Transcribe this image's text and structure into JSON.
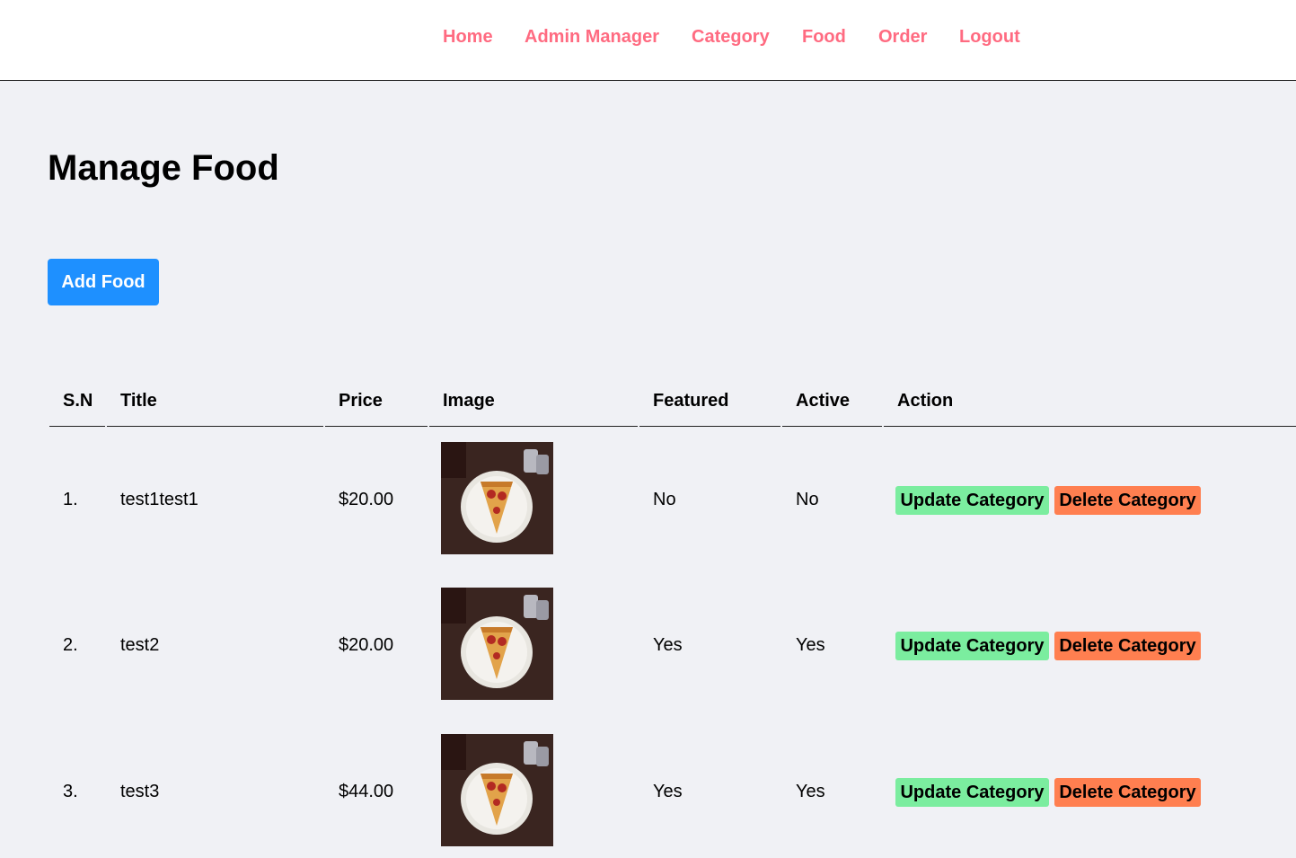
{
  "nav": {
    "items": [
      "Home",
      "Admin Manager",
      "Category",
      "Food",
      "Order",
      "Logout"
    ]
  },
  "page": {
    "title": "Manage Food",
    "add_button": "Add Food"
  },
  "table": {
    "headers": [
      "S.N",
      "Title",
      "Price",
      "Image",
      "Featured",
      "Active",
      "Action"
    ],
    "rows": [
      {
        "sn": "1.",
        "title": "test1test1",
        "price": "$20.00",
        "image": "pizza-slice-image",
        "featured": "No",
        "active": "No",
        "update": "Update Category",
        "delete": "Delete Category"
      },
      {
        "sn": "2.",
        "title": "test2",
        "price": "$20.00",
        "image": "pizza-slice-image",
        "featured": "Yes",
        "active": "Yes",
        "update": "Update Category",
        "delete": "Delete Category"
      },
      {
        "sn": "3.",
        "title": "test3",
        "price": "$44.00",
        "image": "pizza-slice-image",
        "featured": "Yes",
        "active": "Yes",
        "update": "Update Category",
        "delete": "Delete Category"
      }
    ]
  },
  "colors": {
    "nav_link": "#ff6b81",
    "primary_button": "#1e90ff",
    "update_button": "#7bed9f",
    "delete_button": "#ff7f50",
    "page_bg": "#f0f1f5"
  }
}
